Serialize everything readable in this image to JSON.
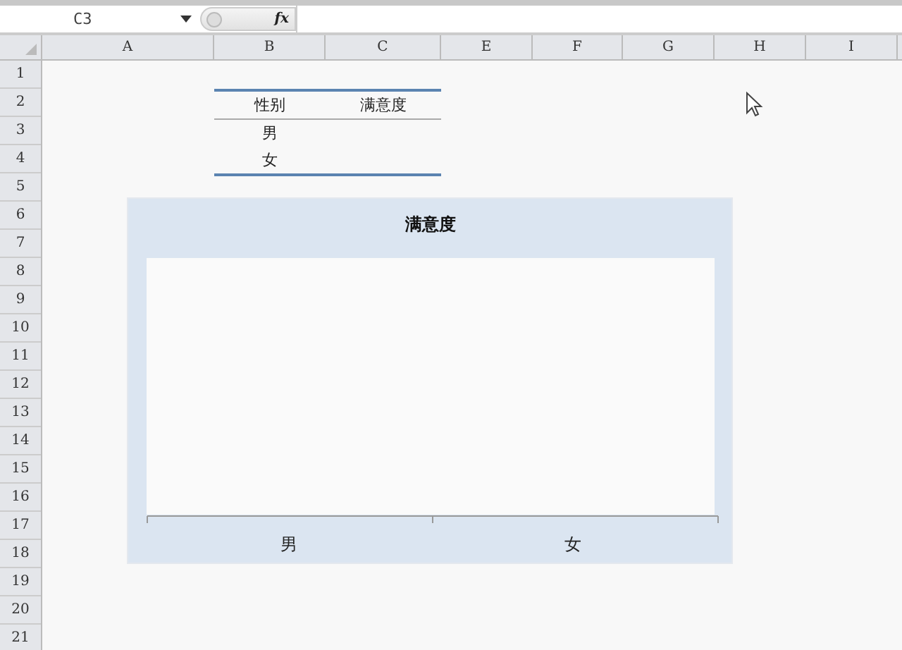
{
  "formula_bar": {
    "name_box": "C3",
    "fx_label": "fx"
  },
  "columns": [
    "A",
    "B",
    "C",
    "E",
    "F",
    "G",
    "H",
    "I"
  ],
  "rows": [
    "1",
    "2",
    "3",
    "4",
    "5",
    "6",
    "7",
    "8",
    "9",
    "10",
    "11",
    "12",
    "13",
    "14",
    "15",
    "16",
    "17",
    "18",
    "19",
    "20",
    "21"
  ],
  "table": {
    "headers": [
      "性别",
      "满意度"
    ],
    "rows": [
      [
        "男"
      ],
      [
        "女"
      ]
    ]
  },
  "chart": {
    "title": "满意度",
    "categories": [
      "男",
      "女"
    ]
  }
}
